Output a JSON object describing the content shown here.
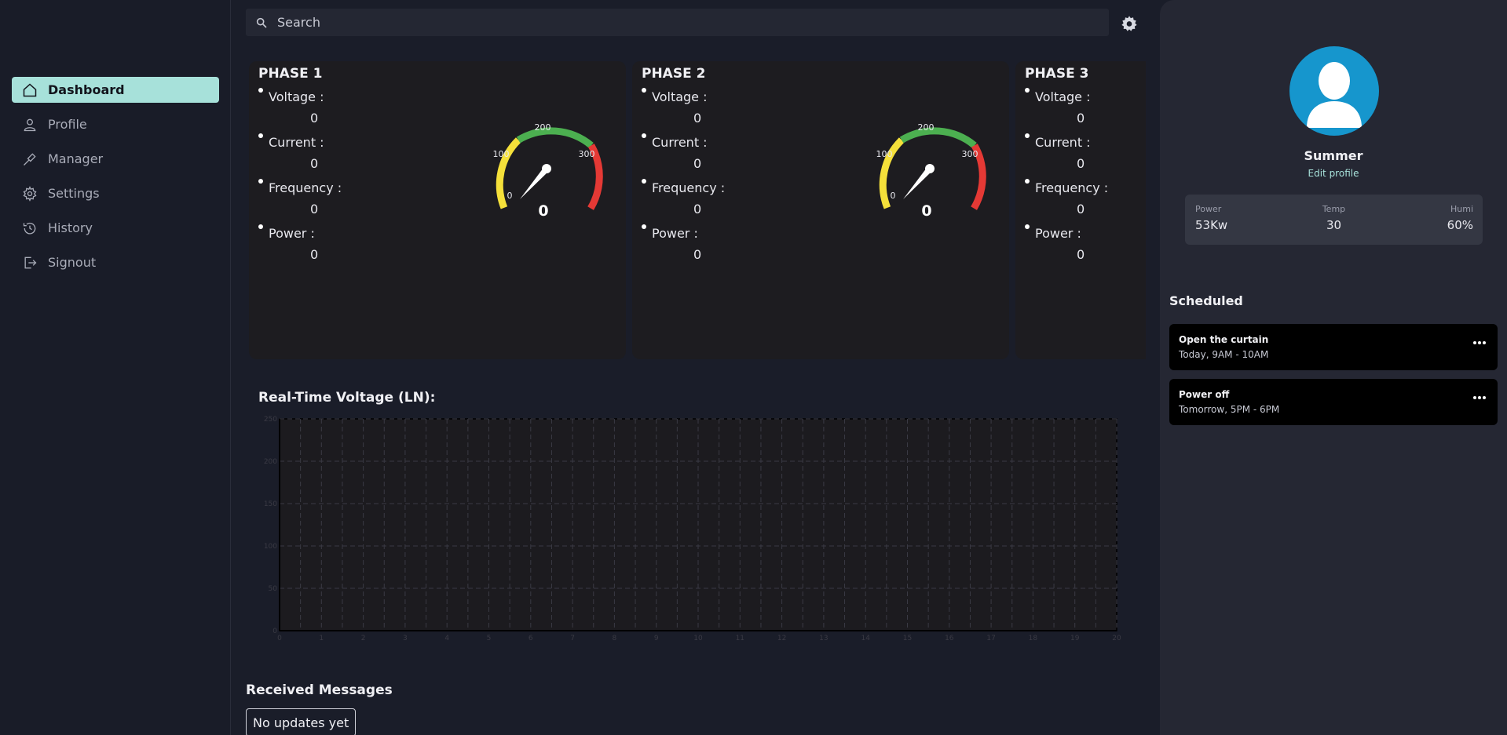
{
  "sidebar": {
    "items": [
      {
        "label": "Dashboard",
        "icon": "home-icon",
        "active": true
      },
      {
        "label": "Profile",
        "icon": "user-icon",
        "active": false
      },
      {
        "label": "Manager",
        "icon": "tool-icon",
        "active": false
      },
      {
        "label": "Settings",
        "icon": "gear-icon",
        "active": false
      },
      {
        "label": "History",
        "icon": "history-icon",
        "active": false
      },
      {
        "label": "Signout",
        "icon": "signout-icon",
        "active": false
      }
    ]
  },
  "header": {
    "search_placeholder": "Search"
  },
  "phases": [
    {
      "title": "PHASE 1",
      "fields": [
        {
          "label": "Voltage :",
          "value": "0"
        },
        {
          "label": "Current :",
          "value": "0"
        },
        {
          "label": "Frequency :",
          "value": "0"
        },
        {
          "label": "Power :",
          "value": "0"
        }
      ],
      "gauge": {
        "value": "0",
        "ticks": [
          "0",
          "100",
          "200",
          "300"
        ]
      }
    },
    {
      "title": "PHASE 2",
      "fields": [
        {
          "label": "Voltage :",
          "value": "0"
        },
        {
          "label": "Current :",
          "value": "0"
        },
        {
          "label": "Frequency :",
          "value": "0"
        },
        {
          "label": "Power :",
          "value": "0"
        }
      ],
      "gauge": {
        "value": "0",
        "ticks": [
          "0",
          "100",
          "200",
          "300"
        ]
      }
    },
    {
      "title": "PHASE 3",
      "fields": [
        {
          "label": "Voltage :",
          "value": "0"
        },
        {
          "label": "Current :",
          "value": "0"
        },
        {
          "label": "Frequency :",
          "value": "0"
        },
        {
          "label": "Power :",
          "value": "0"
        }
      ]
    }
  ],
  "gauge_colors": {
    "low": "#f5e03a",
    "mid": "#4caf50",
    "high": "#e53935"
  },
  "chart_data": {
    "type": "line",
    "title": "Real-Time Voltage (LN):",
    "x": [
      0,
      1,
      2,
      3,
      4,
      5,
      6,
      7,
      8,
      9,
      10,
      11,
      12,
      13,
      14,
      15,
      16,
      17,
      18,
      19,
      20
    ],
    "xlim": [
      0,
      20
    ],
    "ylim": [
      0,
      250
    ],
    "y_ticks": [
      0,
      50,
      100,
      150,
      200,
      250
    ],
    "series": [],
    "grid": true
  },
  "messages": {
    "title": "Received Messages",
    "empty_text": "No updates yet"
  },
  "profile": {
    "name": "Summer",
    "edit_label": "Edit profile",
    "stats": [
      {
        "label": "Power",
        "value": "53Kw"
      },
      {
        "label": "Temp",
        "value": "30"
      },
      {
        "label": "Humi",
        "value": "60%"
      }
    ]
  },
  "schedule": {
    "title": "Scheduled",
    "tasks": [
      {
        "title": "Open the curtain",
        "time": "Today, 9AM - 10AM"
      },
      {
        "title": "Power off",
        "time": "Tomorrow, 5PM - 6PM"
      }
    ]
  }
}
